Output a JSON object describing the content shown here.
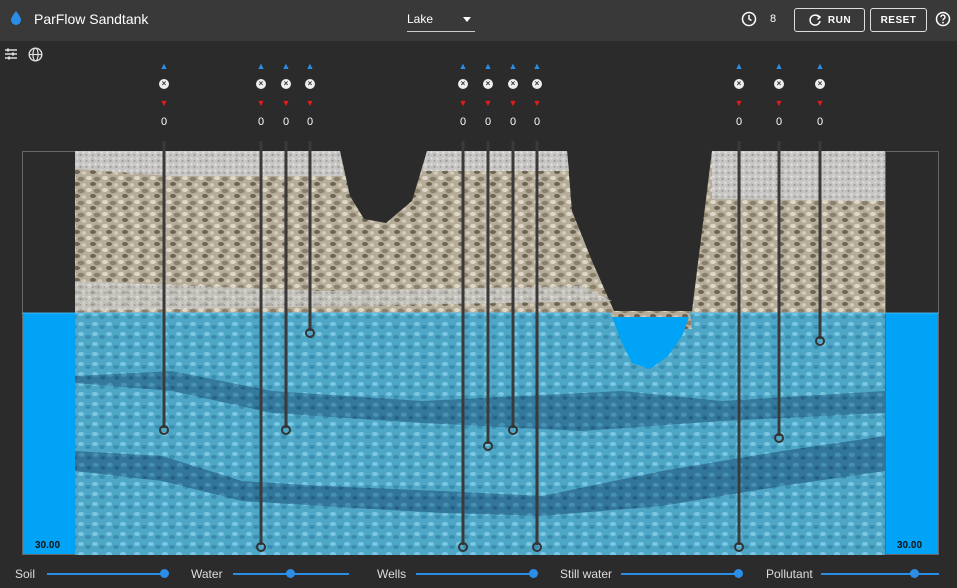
{
  "header": {
    "title": "ParFlow Sandtank",
    "scenario": "Lake",
    "step_count": "8",
    "run_label": "RUN",
    "reset_label": "RESET"
  },
  "tank": {
    "left_level": "30.00",
    "right_level": "30.00",
    "water_color": "#00a3f5"
  },
  "wells": [
    {
      "value": "0",
      "depth": 0.7
    },
    {
      "value": "0",
      "depth": 0.99
    },
    {
      "value": "0",
      "depth": 0.7
    },
    {
      "value": "0",
      "depth": 0.46
    },
    {
      "value": "0",
      "depth": 0.99
    },
    {
      "value": "0",
      "depth": 0.74
    },
    {
      "value": "0",
      "depth": 0.7
    },
    {
      "value": "0",
      "depth": 0.99
    },
    {
      "value": "0",
      "depth": 0.99
    },
    {
      "value": "0",
      "depth": 0.72
    },
    {
      "value": "0",
      "depth": 0.48
    }
  ],
  "sliders": [
    {
      "label": "Soil",
      "value": 1.0
    },
    {
      "label": "Water",
      "value": 0.5
    },
    {
      "label": "Wells",
      "value": 1.0
    },
    {
      "label": "Still water",
      "value": 1.0
    },
    {
      "label": "Pollutant",
      "value": 0.8
    }
  ],
  "colors": {
    "accent": "#2a8ee6",
    "extract": "#e21b1b",
    "inject": "#2a8ee6"
  }
}
